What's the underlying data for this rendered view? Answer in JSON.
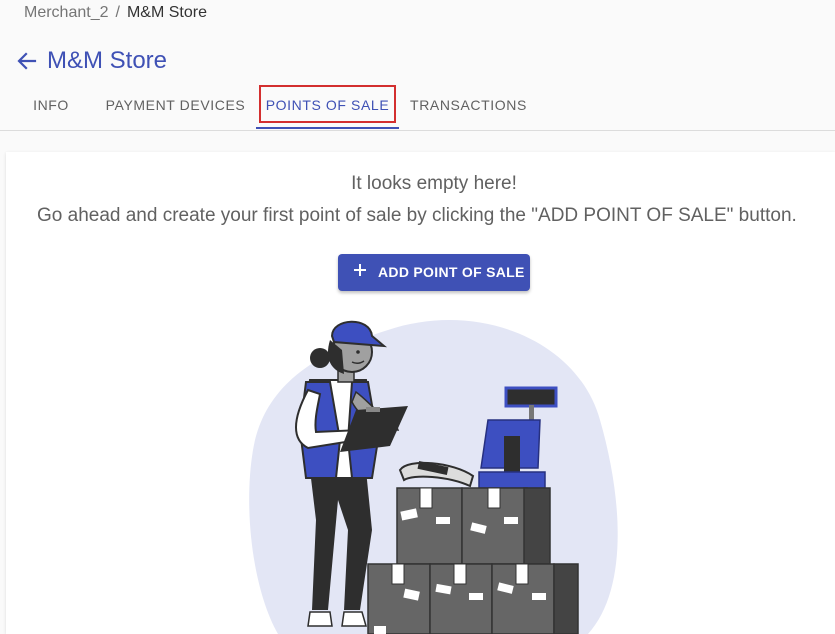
{
  "breadcrumb": {
    "parent": "Merchant_2",
    "separator": "/",
    "current": "M&M Store"
  },
  "header": {
    "title": "M&M Store",
    "back_icon": "arrow-left-icon"
  },
  "tabs": [
    {
      "label": "INFO",
      "active": false
    },
    {
      "label": "PAYMENT DEVICES",
      "active": false
    },
    {
      "label": "POINTS OF SALE",
      "active": true
    },
    {
      "label": "TRANSACTIONS",
      "active": false
    }
  ],
  "empty_state": {
    "line1": "It looks empty here!",
    "line2": "Go ahead and create your first point of sale by clicking the \"ADD POINT OF SALE\" button.",
    "button_label": "ADD POINT OF SALE",
    "button_icon": "plus-icon",
    "illustration": "cashier-with-boxes-illustration"
  },
  "colors": {
    "accent": "#3f51b5",
    "highlight_border": "#d32f2f",
    "text": "#616161",
    "blob": "#e3e6f5"
  }
}
